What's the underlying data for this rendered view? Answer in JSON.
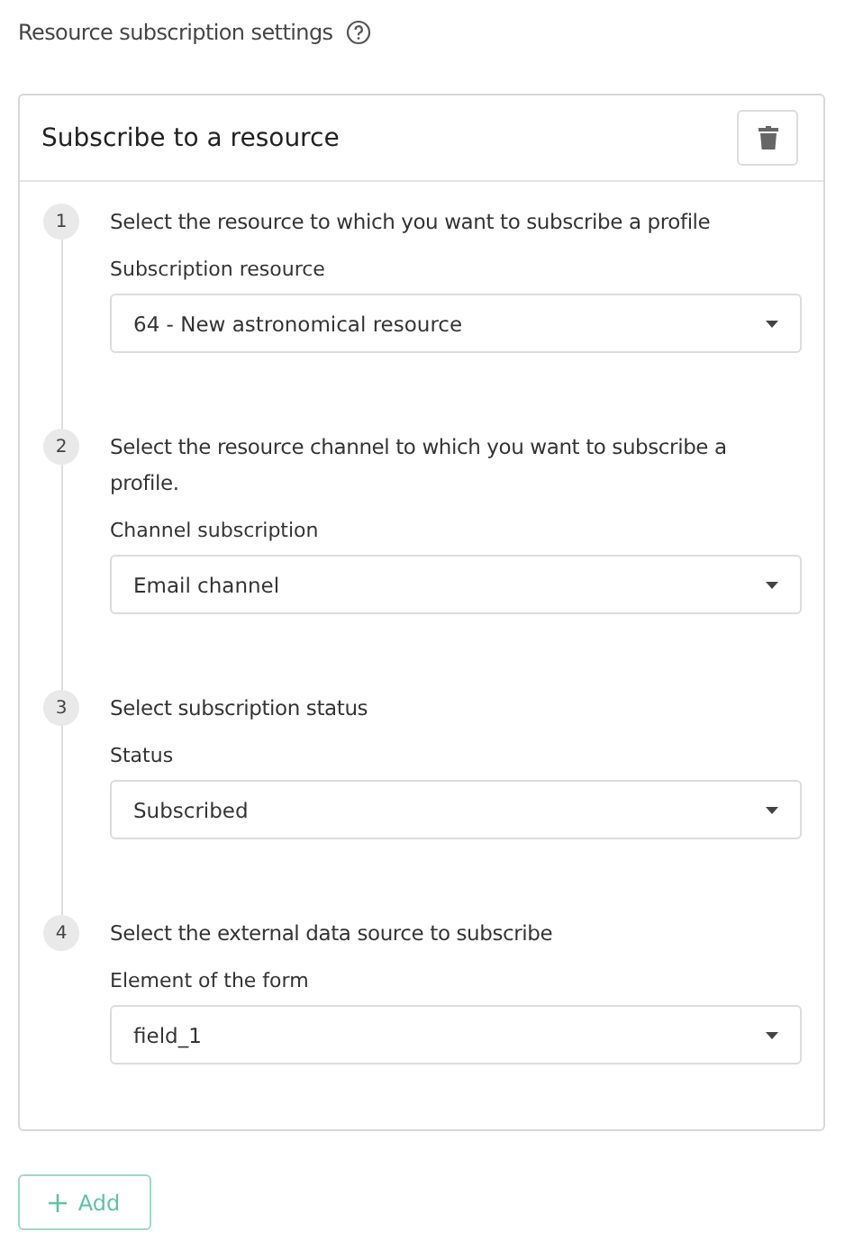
{
  "page_title": "Resource subscription settings",
  "card": {
    "title": "Subscribe to a resource",
    "steps": [
      {
        "number": "1",
        "title": "Select the resource to which you want to subscribe a profile",
        "label": "Subscription resource",
        "value": "64 - New astronomical resource"
      },
      {
        "number": "2",
        "title": "Select the resource channel to which you want to subscribe a profile.",
        "label": "Channel subscription",
        "value": "Email channel"
      },
      {
        "number": "3",
        "title": "Select subscription status",
        "label": "Status",
        "value": "Subscribed"
      },
      {
        "number": "4",
        "title": "Select the external data source to subscribe",
        "label": "Element of the form",
        "value": "field_1"
      }
    ]
  },
  "add_button": "Add"
}
